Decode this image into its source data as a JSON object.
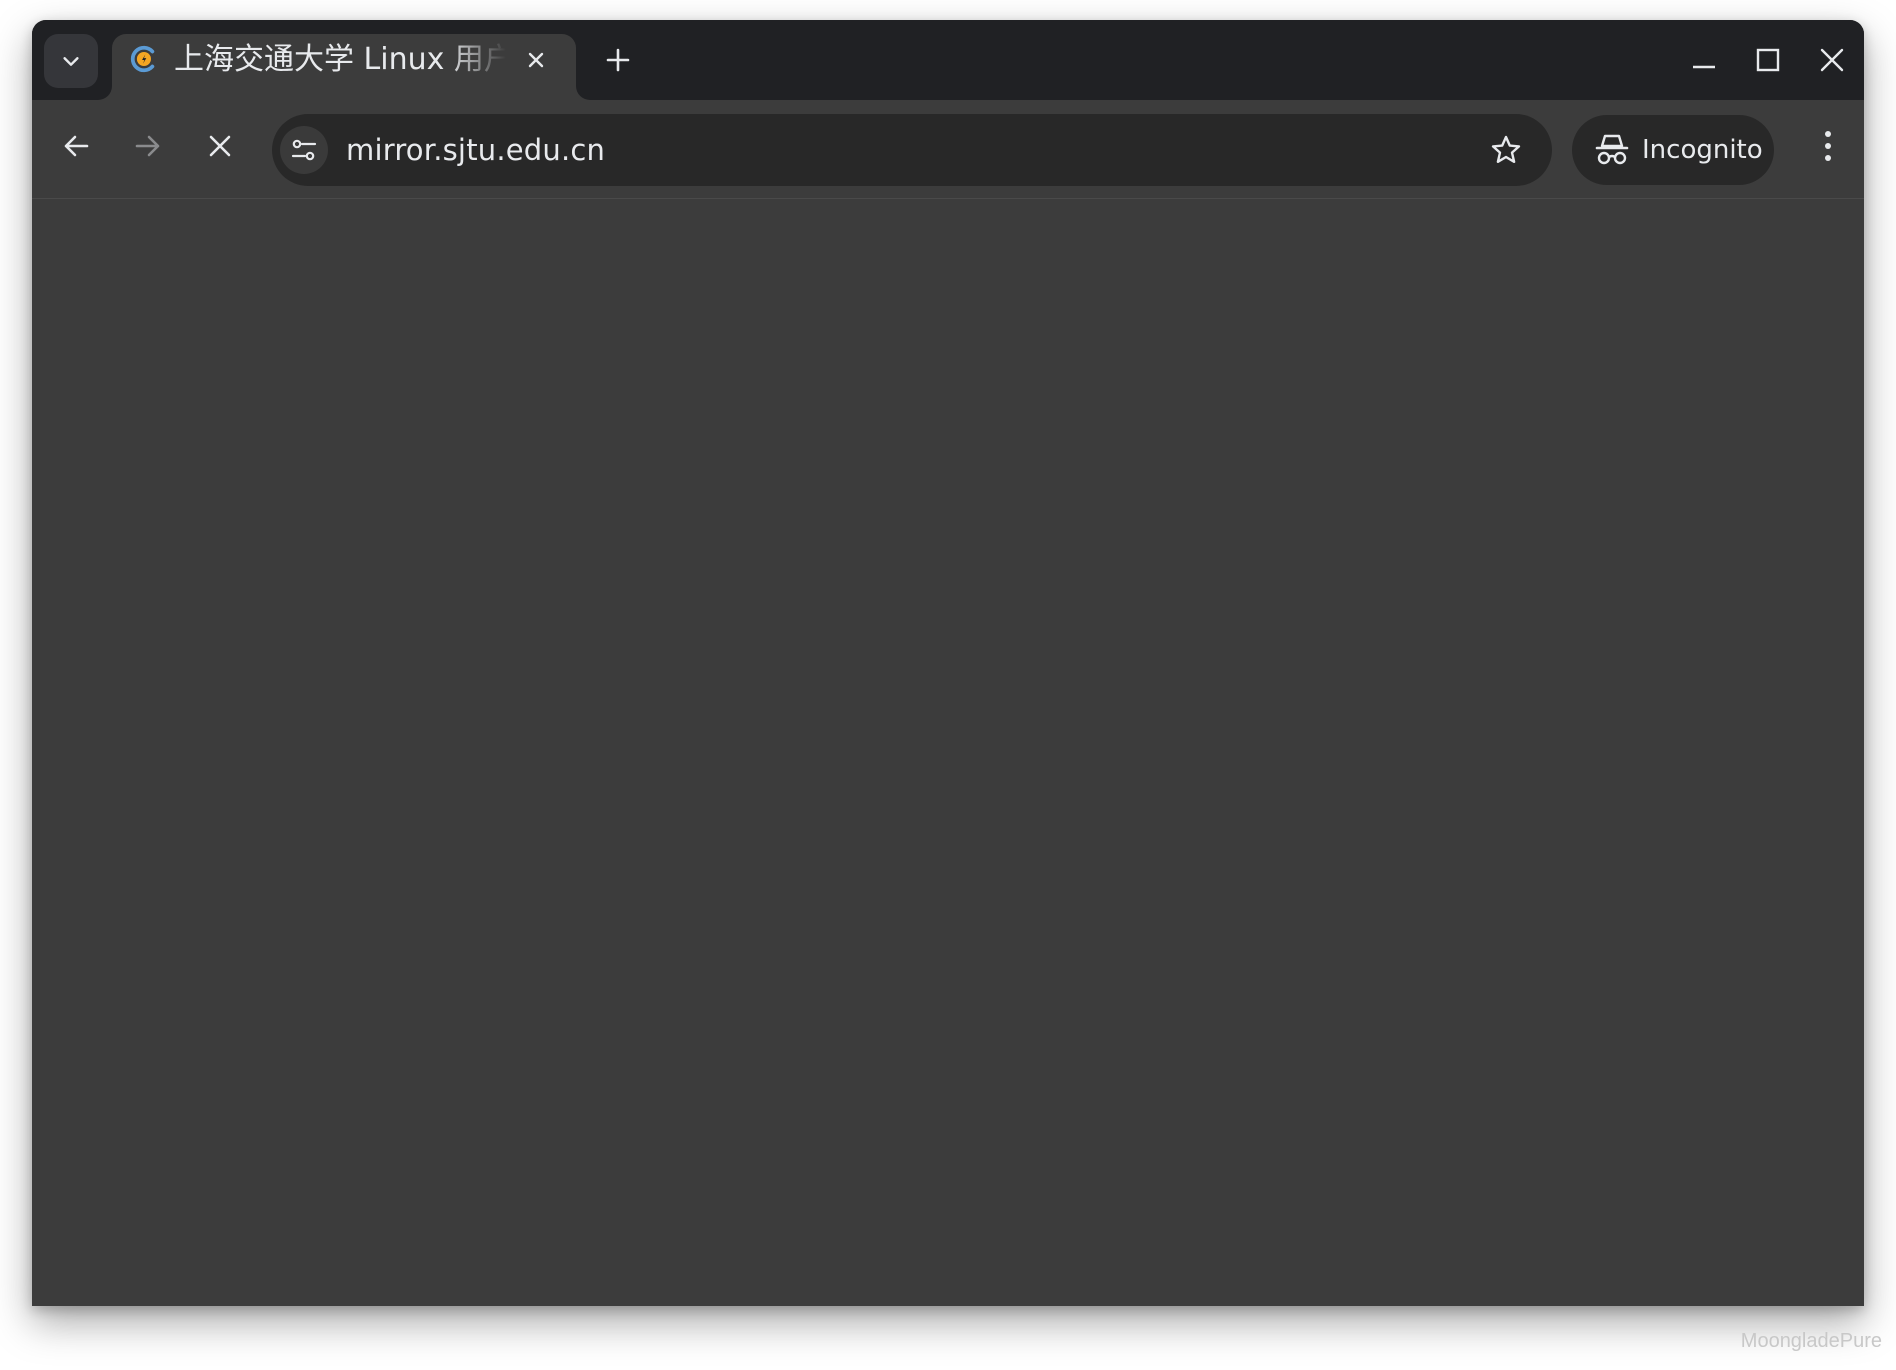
{
  "tab": {
    "title": "上海交通大学 Linux 用户组"
  },
  "omnibox": {
    "url": "mirror.sjtu.edu.cn"
  },
  "profile": {
    "label": "Incognito"
  },
  "watermark": "MoongladePure",
  "colors": {
    "tabstrip": "#202124",
    "toolbar": "#3c3c3c",
    "omnibox": "#282828",
    "text": "#e8eaed",
    "favicon_blue": "#5b9bd5",
    "favicon_orange": "#f5a623"
  },
  "icons": {
    "tab_search": "chevron-down-icon",
    "favicon": "sjtug-logo-icon",
    "tab_close": "close-icon",
    "new_tab": "plus-icon",
    "minimize": "minimize-icon",
    "maximize": "maximize-icon",
    "close_window": "close-icon",
    "back": "arrow-left-icon",
    "forward": "arrow-right-icon",
    "stop": "close-icon",
    "site_info": "tune-icon",
    "bookmark": "star-icon",
    "incognito": "incognito-icon",
    "menu": "kebab-menu-icon"
  }
}
